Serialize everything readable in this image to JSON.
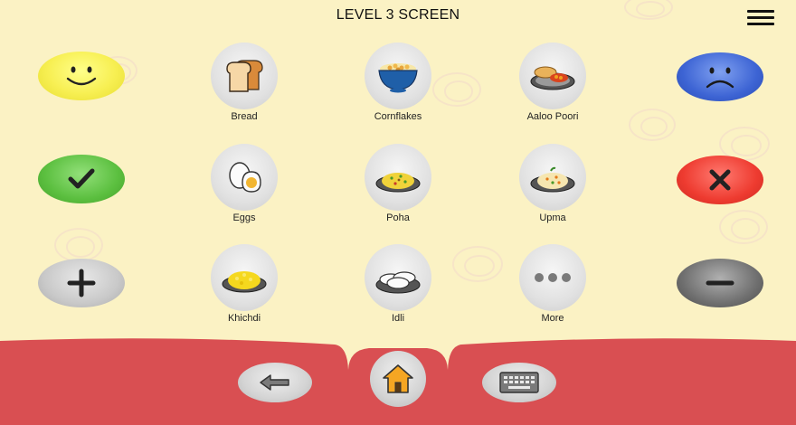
{
  "header": {
    "title": "LEVEL 3 SCREEN",
    "menu_icon": "hamburger-menu-icon"
  },
  "left_buttons": [
    {
      "name": "happy-button",
      "icon": "smiley-icon",
      "color": "#f5ec4f"
    },
    {
      "name": "yes-button",
      "icon": "checkmark-icon",
      "color": "#5bbf3f"
    },
    {
      "name": "more-button",
      "icon": "plus-icon",
      "color": "#c9c9c9"
    }
  ],
  "right_buttons": [
    {
      "name": "sad-button",
      "icon": "sad-face-icon",
      "color": "#3d64d4"
    },
    {
      "name": "no-button",
      "icon": "cross-icon",
      "color": "#ee3b30"
    },
    {
      "name": "less-button",
      "icon": "minus-icon",
      "color": "#707070"
    }
  ],
  "items": [
    {
      "label": "Bread",
      "icon": "bread-icon"
    },
    {
      "label": "Cornflakes",
      "icon": "cornflakes-bowl-icon"
    },
    {
      "label": "Aaloo Poori",
      "icon": "aaloo-poori-icon"
    },
    {
      "label": "Eggs",
      "icon": "egg-icon"
    },
    {
      "label": "Poha",
      "icon": "poha-icon"
    },
    {
      "label": "Upma",
      "icon": "upma-icon"
    },
    {
      "label": "Khichdi",
      "icon": "khichdi-icon"
    },
    {
      "label": "Idli",
      "icon": "idli-icon"
    },
    {
      "label": "More",
      "icon": "ellipsis-icon"
    }
  ],
  "bottom_nav": [
    {
      "name": "back-button",
      "icon": "back-arrow-icon"
    },
    {
      "name": "home-button",
      "icon": "home-icon"
    },
    {
      "name": "keyboard-button",
      "icon": "keyboard-icon"
    }
  ],
  "colors": {
    "background": "#fbf2c4",
    "bottom_bar": "#d94f52",
    "home_icon": "#f5a623"
  }
}
